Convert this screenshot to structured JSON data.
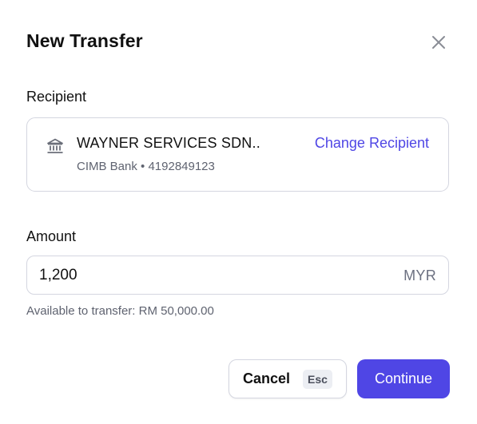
{
  "dialog": {
    "title": "New Transfer",
    "close_icon": "close-icon"
  },
  "recipient": {
    "label": "Recipient",
    "icon": "bank-icon",
    "name": "WAYNER SERVICES SDN..",
    "meta": "CIMB Bank • 4192849123",
    "change_label": "Change Recipient"
  },
  "amount": {
    "label": "Amount",
    "value": "1,200",
    "currency": "MYR",
    "available": "Available to transfer: RM 50,000.00"
  },
  "actions": {
    "cancel_label": "Cancel",
    "cancel_shortcut": "Esc",
    "continue_label": "Continue"
  },
  "colors": {
    "accent": "#4f46e5",
    "border": "#d4d6e0",
    "muted_text": "#5f6370"
  }
}
